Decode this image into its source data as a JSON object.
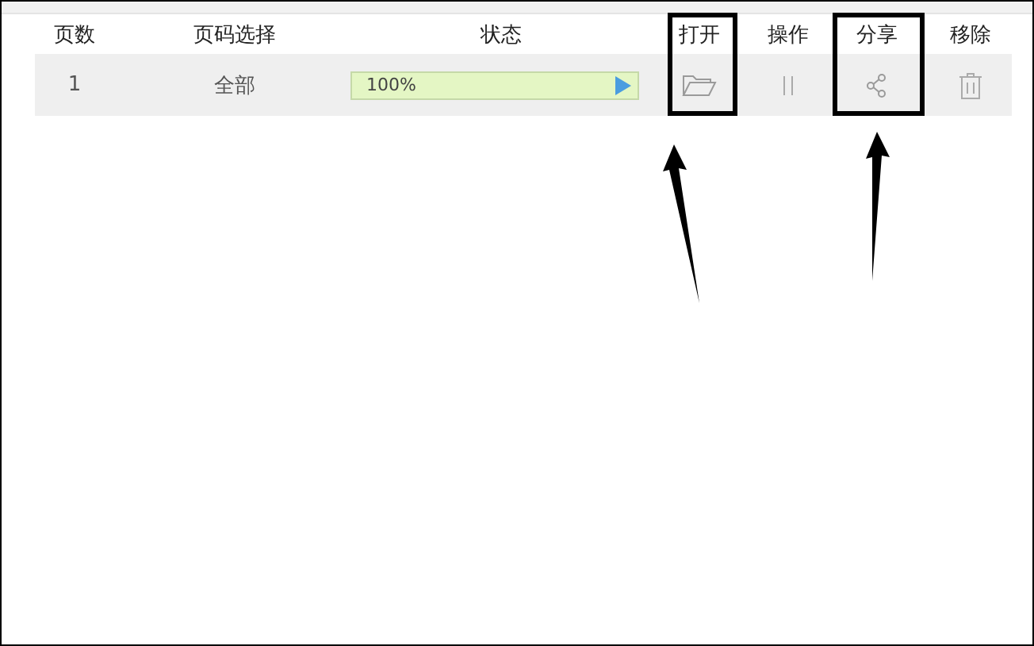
{
  "table": {
    "columns": [
      {
        "label": "页数",
        "highlighted": false
      },
      {
        "label": "页码选择",
        "highlighted": false
      },
      {
        "label": "状态",
        "highlighted": false
      },
      {
        "label": "打开",
        "highlighted": true
      },
      {
        "label": "操作",
        "highlighted": false
      },
      {
        "label": "分享",
        "highlighted": true
      },
      {
        "label": "移除",
        "highlighted": false
      }
    ],
    "rows": [
      {
        "page": "1",
        "range": "全部",
        "progress": {
          "level": 1,
          "reading": "100%"
        }
      }
    ]
  }
}
